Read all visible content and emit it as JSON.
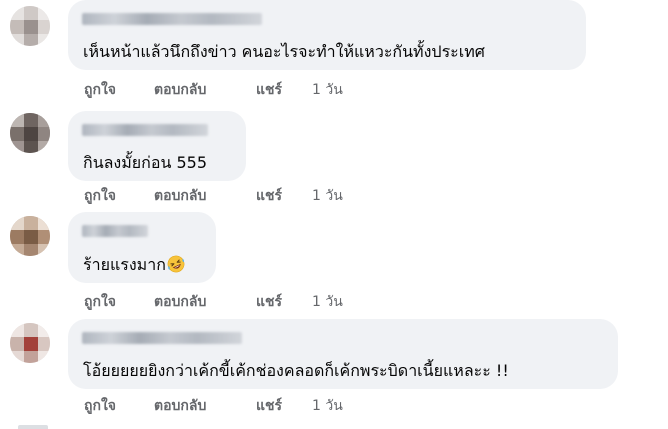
{
  "comments": [
    {
      "author": "",
      "text": "เห็นหน้าแล้วนึกถึงข่าว คนอะไรจะทำให้แหวะกันทั้งประเทศ",
      "like": "ถูกใจ",
      "reply": "ตอบกลับ",
      "share": "แชร์",
      "time": "1 วัน"
    },
    {
      "author": "",
      "text": "กินลงมั้ยก่อน 555",
      "like": "ถูกใจ",
      "reply": "ตอบกลับ",
      "share": "แชร์",
      "time": "1 วัน"
    },
    {
      "author": "",
      "text": "ร้ายแรงมาก",
      "emoji": "rolling-on-floor-laughing-emoji",
      "like": "ถูกใจ",
      "reply": "ตอบกลับ",
      "share": "แชร์",
      "time": "1 วัน"
    },
    {
      "author": "",
      "text": "โอ้ยยยยยยิงกว่าเค้กขี้เค้กช่องคลอดก็เค้กพระบิดาเนี้ยแหละะ !!",
      "like": "ถูกใจ",
      "reply": "ตอบกลับ",
      "share": "แชร์",
      "time": "1 วัน"
    }
  ],
  "colors": {
    "bubble": "#f0f2f5",
    "action_text": "#65676b",
    "body_text": "#050505"
  }
}
